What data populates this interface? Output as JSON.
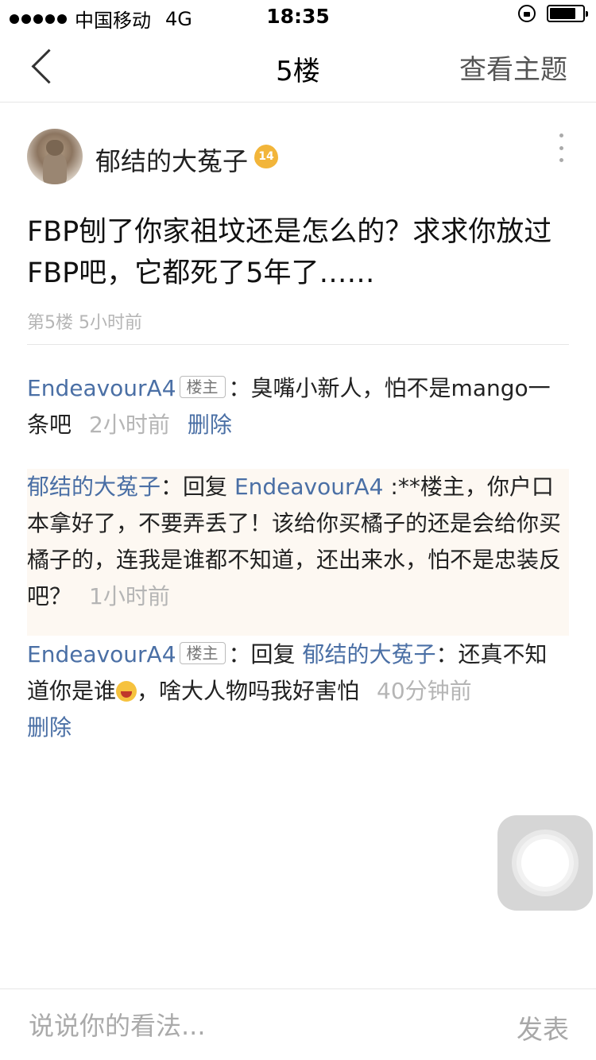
{
  "status_bar": {
    "carrier": "中国移动",
    "network": "4G",
    "time": "18:35",
    "battery_level": 0.8
  },
  "nav": {
    "title": "5楼",
    "view_topic_label": "查看主题"
  },
  "post": {
    "author": "郁结的大菟子",
    "level": "14",
    "body": "FBP刨了你家祖坟还是怎么的？求求你放过FBP吧，它都死了5年了……",
    "meta": "第5楼 5小时前"
  },
  "replies": [
    {
      "user": "EndeavourA4",
      "tag": "楼主",
      "sep": "：",
      "text": "臭嘴小新人，怕不是mango一条吧",
      "time": "2小时前",
      "delete_label": "删除"
    },
    {
      "user": "郁结的大菟子",
      "sep": "：",
      "reply_prefix": "回复",
      "reply_to": "EndeavourA4",
      "text": ":**楼主，你户口本拿好了，不要弄丢了！该给你买橘子的还是会给你买橘子的，连我是谁都不知道，还出来水，怕不是忠装反吧？",
      "time": "1小时前"
    },
    {
      "user": "EndeavourA4",
      "tag": "楼主",
      "sep": "：",
      "reply_prefix": "回复",
      "reply_to": "郁结的大菟子",
      "text_before_emoji": "：还真不知道你是谁",
      "text_after_emoji": "，啥大人物吗我好害怕",
      "time": "40分钟前",
      "delete_label": "删除"
    }
  ],
  "comment_bar": {
    "placeholder": "说说你的看法...",
    "send_label": "发表"
  },
  "colors": {
    "link_blue": "#4a6fa5",
    "muted_gray": "#b5b5b5",
    "highlight_bg": "#fdf8f2",
    "badge_gold": "#f2b53a"
  }
}
